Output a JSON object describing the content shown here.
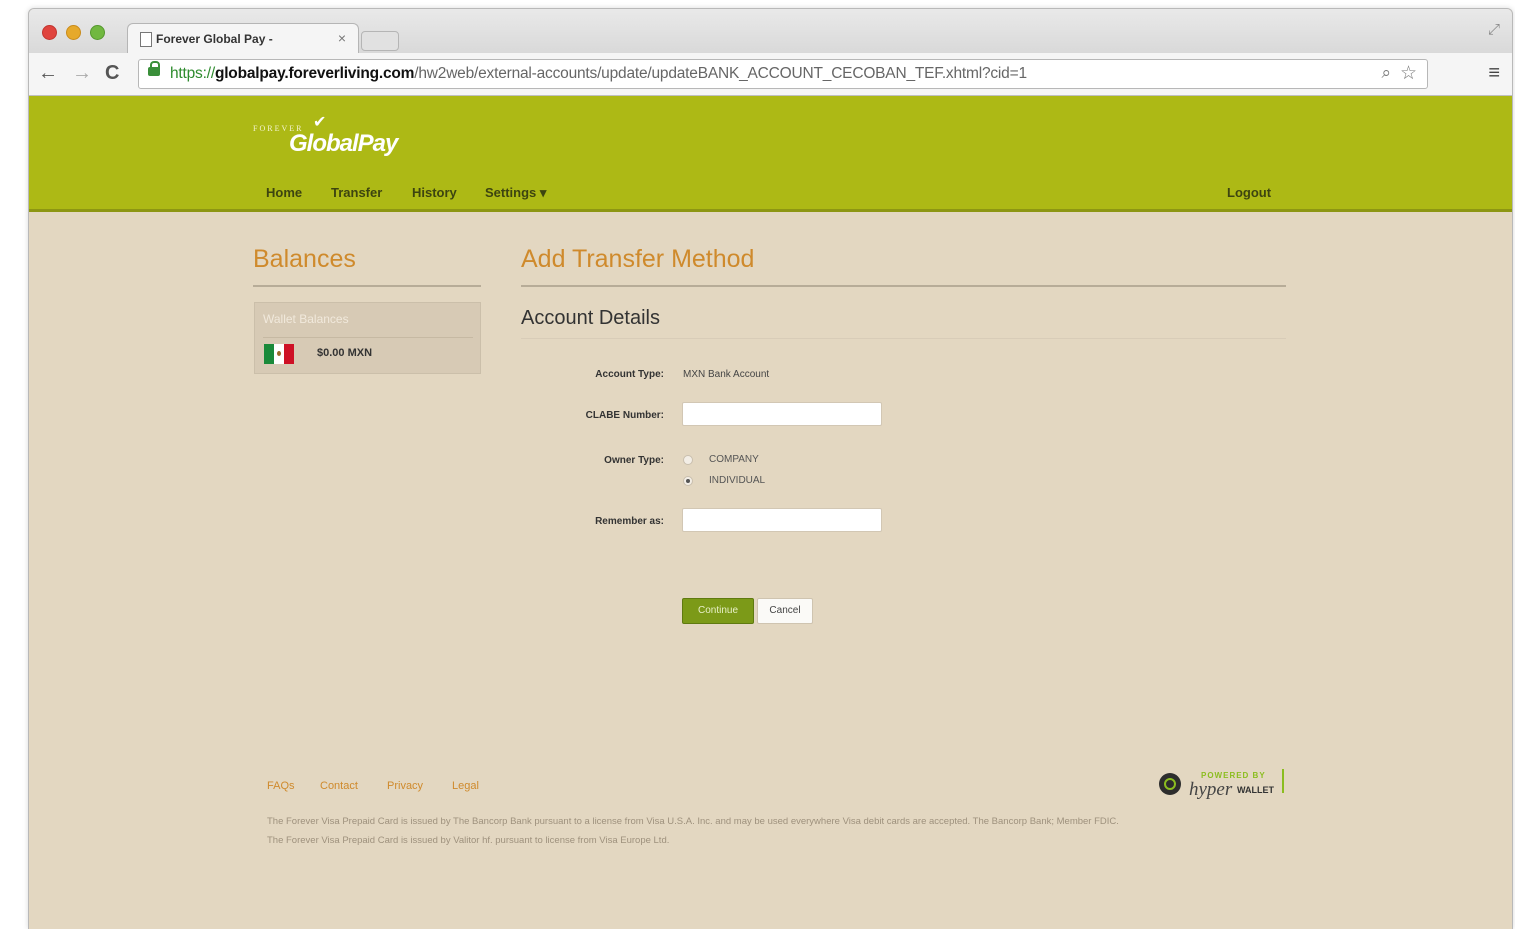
{
  "browser": {
    "tab_title": "Forever Global Pay -",
    "tab_close": "×",
    "url_scheme": "https://",
    "url_host": "globalpay.foreverliving.com",
    "url_path": "/hw2web/external-accounts/update/updateBANK_ACCOUNT_CECOBAN_TEF.xhtml?cid=1",
    "back": "←",
    "forward": "→",
    "reload": "C",
    "zoom": "⌕",
    "star": "☆",
    "menu": "≡",
    "resize": "⤢"
  },
  "header": {
    "logo_small": "FOREVER",
    "logo_main": "GlobalPay",
    "nav": [
      "Home",
      "Transfer",
      "History",
      "Settings ▾"
    ],
    "logout": "Logout"
  },
  "balances": {
    "title": "Balances",
    "wallet_label": "Wallet Balances",
    "amount": "$0.00 MXN"
  },
  "main": {
    "title": "Add Transfer Method",
    "section": "Account Details",
    "account_type_label": "Account Type:",
    "account_type_value": "MXN Bank Account",
    "clabe_label": "CLABE Number:",
    "clabe_value": "",
    "owner_type_label": "Owner Type:",
    "owner_options": [
      "COMPANY",
      "INDIVIDUAL"
    ],
    "owner_selected": "INDIVIDUAL",
    "remember_label": "Remember as:",
    "remember_value": "",
    "continue": "Continue",
    "cancel": "Cancel"
  },
  "footer": {
    "links": [
      "FAQs",
      "Contact",
      "Privacy",
      "Legal"
    ],
    "line1": "The Forever Visa Prepaid Card is issued by The Bancorp Bank pursuant to a license from Visa U.S.A. Inc. and may be used everywhere Visa debit cards are accepted. The Bancorp Bank; Member FDIC.",
    "line2": "The Forever Visa Prepaid Card is issued by Valitor hf. pursuant to license from Visa Europe Ltd.",
    "powered_by": "POWERED BY",
    "hyper": "hyper",
    "wallet": "WALLET"
  },
  "colors": {
    "header_green": "#adb915",
    "accent_orange": "#cf8a2c",
    "page_bg": "#e3d7c1",
    "continue_green": "#7c9a18"
  }
}
